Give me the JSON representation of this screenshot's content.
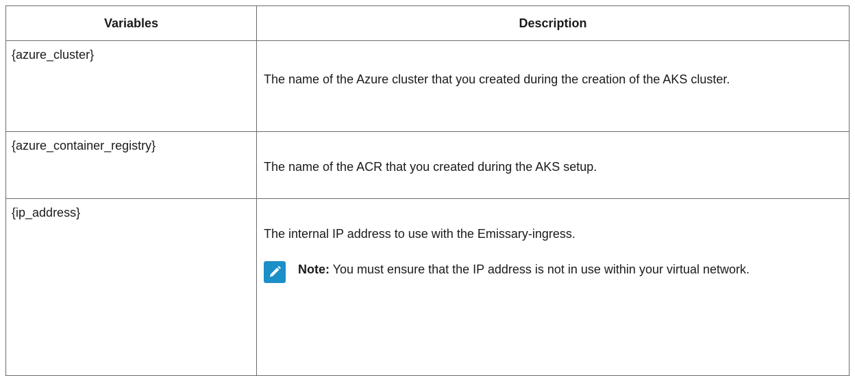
{
  "table": {
    "headers": {
      "variables": "Variables",
      "description": "Description"
    },
    "rows": [
      {
        "variable": "{azure_cluster}",
        "description": "The name of the Azure cluster that you created during the creation of the AKS cluster."
      },
      {
        "variable": "{azure_container_registry}",
        "description": "The name of the ACR that you created during the AKS setup."
      },
      {
        "variable": "{ip_address}",
        "description": "The internal IP address to use with the Emissary-ingress.",
        "note": {
          "label": "Note:",
          "text": " You must ensure that the IP address is not in use within your virtual network.",
          "icon": "pencil-icon",
          "icon_color": "#1b8fc7"
        }
      }
    ]
  }
}
